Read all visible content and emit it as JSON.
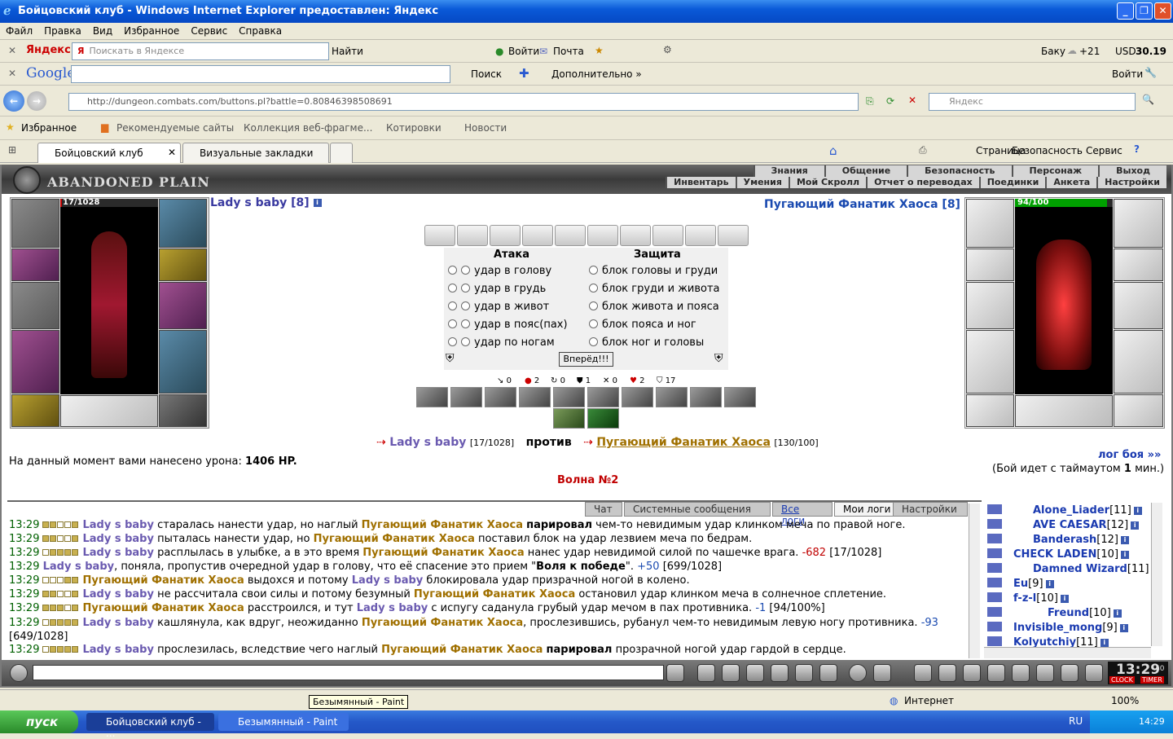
{
  "window": {
    "title": "Бойцовский клуб - Windows Internet Explorer предоставлен: Яндекс"
  },
  "menu": [
    "Файл",
    "Правка",
    "Вид",
    "Избранное",
    "Сервис",
    "Справка"
  ],
  "yandex_bar": {
    "brand": "Яндекс",
    "search_placeholder": "Поискать в Яндексе",
    "find": "Найти",
    "login": "Войти",
    "mail": "Почта",
    "city": "Баку",
    "temp": "+21",
    "usd_label": "USD",
    "usd_value": "30.19"
  },
  "google_bar": {
    "brand": "Google",
    "search": "Поиск",
    "more": "Дополнительно »",
    "login": "Войти"
  },
  "address": {
    "url": "http://dungeon.combats.com/buttons.pl?battle=0.80846398508691",
    "search_placeholder": "Яндекс"
  },
  "favorites": {
    "label": "Избранное",
    "items": [
      "Рекомендуемые сайты",
      "Коллекция веб-фрагме...",
      "Котировки",
      "Новости"
    ]
  },
  "tabs": [
    "Бойцовский клуб",
    "Визуальные закладки"
  ],
  "commandbar": {
    "page": "Страница",
    "security": "Безопасность",
    "service": "Сервис"
  },
  "game": {
    "logo": "ABANDONED PLAIN",
    "nav_top": [
      "Знания",
      "Общение",
      "Безопасность",
      "Персонаж",
      "Выход"
    ],
    "nav_bottom": [
      "Инвентарь",
      "Умения",
      "Мой Скролл",
      "Отчет о переводах",
      "Поединки",
      "Анкета",
      "Настройки"
    ],
    "player": {
      "hp": "17/1028",
      "hp_fraction": 0.017,
      "name": "Lady s baby [8]",
      "info": "i"
    },
    "enemy": {
      "hp": "94/100",
      "hp_fraction": 0.94,
      "name": "Пугающий Фанатик Хаоса [8]",
      "info": "i"
    },
    "attack_title": "Атака",
    "defense_title": "Защита",
    "attacks": [
      "удар в голову",
      "удар в грудь",
      "удар в живот",
      "удар в пояс(пах)",
      "удар по ногам"
    ],
    "defenses": [
      "блок головы и груди",
      "блок груди и живота",
      "блок живота и пояса",
      "блок пояса и ног",
      "блок ног и головы"
    ],
    "forward": "Вперёд!!!",
    "stats": [
      "0",
      "2",
      "0",
      "1",
      "0",
      "2",
      "17"
    ],
    "versus": {
      "player": "Lady s baby",
      "player_hp": "[17/1028]",
      "word": "против",
      "enemy": "Пугающий Фанатик Хаоса",
      "enemy_hp": "[130/100]"
    },
    "damage_text": "На данный момент вами нанесено урона:",
    "damage_value": "1406 HP.",
    "battle_log_link": "лог боя »»",
    "timeout_pre": "(Бой идет с таймаутом",
    "timeout_num": "1",
    "timeout_post": "мин.)",
    "wave": "Волна №2"
  },
  "logtabs": [
    "Чат",
    "Системные сообщения",
    "Все логи",
    "Мои логи",
    "Настройки"
  ],
  "log": [
    {
      "time": "13:29",
      "a": "Lady s baby",
      "t1": " старалась нанести удар, но наглый ",
      "b": "Пугающий Фанатик Хаоса",
      "t2": " ",
      "bold": "парировал",
      "t3": " чем-то невидимым удар клинком меча по правой ноге."
    },
    {
      "time": "13:29",
      "a": "Lady s baby",
      "t1": " пыталась нанести удар, но ",
      "b": "Пугающий Фанатик Хаоса",
      "t2": " поставил блок на удар лезвием меча по бедрам.",
      "bold": "",
      "t3": ""
    },
    {
      "time": "13:29",
      "a": "Lady s baby",
      "t1": " расплылась в улыбке, а в это время ",
      "b": "Пугающий Фанатик Хаоса",
      "t2": " нанес удар невидимой силой по чашечке врага. ",
      "red": "-682",
      "t3": " [17/1028]"
    },
    {
      "time": "13:29",
      "a": "Lady s baby",
      "t1": ", поняла, пропустив очередной удар в голову, что её спасение это прием \"",
      "boldq": "Воля к победе",
      "t2": "\". ",
      "blue": "+50",
      "t3": " [699/1028]"
    },
    {
      "time": "13:29",
      "b": "Пугающий Фанатик Хаоса",
      "t1": " выдохся и потому ",
      "a": "Lady s baby",
      "t2": " блокировала удар призрачной ногой в колено."
    },
    {
      "time": "13:29",
      "a": "Lady s baby",
      "t1": " не рассчитала свои силы и потому безумный ",
      "b": "Пугающий Фанатик Хаоса",
      "t2": " остановил удар клинком меча в солнечное сплетение."
    },
    {
      "time": "13:29",
      "b": "Пугающий Фанатик Хаоса",
      "t1": " расстроился, и тут ",
      "a": "Lady s baby",
      "t2": " с испугу саданула грубый удар мечом в пах противника. ",
      "blue": "-1",
      "t3": " [94/100%]"
    },
    {
      "time": "13:29",
      "a": "Lady s baby",
      "t1": " кашлянула, как вдруг, неожиданно ",
      "b": "Пугающий Фанатик Хаоса",
      "t2": ", прослезившись, рубанул чем-то невидимым левую ногу противника. ",
      "blue": "-93",
      "t3": ""
    },
    {
      "time": "",
      "cont": "[649/1028]"
    },
    {
      "time": "13:29",
      "a": "Lady s baby",
      "t1": " прослезилась, вследствие чего наглый ",
      "b": "Пугающий Фанатик Хаоса",
      "t2": " ",
      "bold": "парировал",
      "t3": " прозрачной ногой удар гардой в сердце."
    }
  ],
  "users": [
    {
      "name": "Alone_Liader",
      "lv": "[11]"
    },
    {
      "name": "AVE CAESAR",
      "lv": "[12]"
    },
    {
      "name": "Banderash",
      "lv": "[12]"
    },
    {
      "name": "CHECK LADEN",
      "lv": "[10]"
    },
    {
      "name": "Damned Wizard",
      "lv": "[11]"
    },
    {
      "name": "Eu",
      "lv": "[9]"
    },
    {
      "name": "f-z-l",
      "lv": "[10]"
    },
    {
      "name": "Freund",
      "lv": "[10]"
    },
    {
      "name": "Invisible_mong",
      "lv": "[9]"
    },
    {
      "name": "Kolyutchiy",
      "lv": "[11]"
    }
  ],
  "clock": {
    "time": "13:29",
    "sec": "40",
    "label1": "CLOCK",
    "label2": "TIMER"
  },
  "statusbar": {
    "zone": "Интернет",
    "zoom": "100%"
  },
  "tooltip": "Безымянный - Paint",
  "taskbar": {
    "start": "пуск",
    "tasks": [
      "Бойцовский клуб - ...",
      "Безымянный - Paint"
    ],
    "lang": "RU",
    "time": "14:29"
  }
}
